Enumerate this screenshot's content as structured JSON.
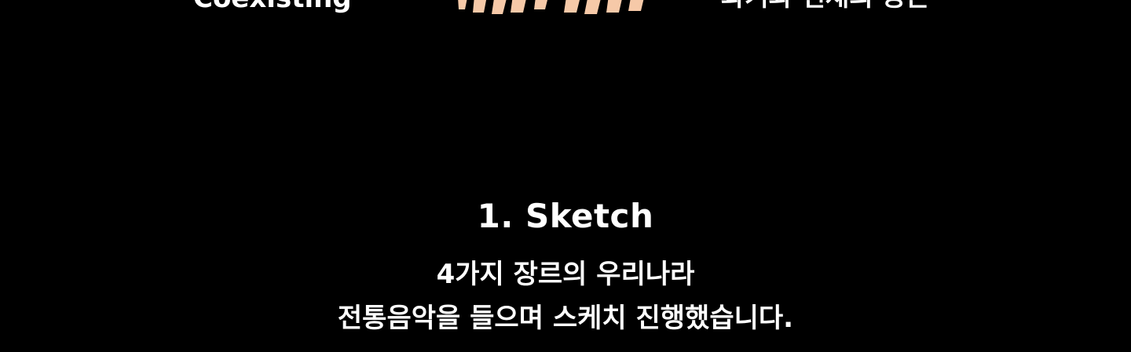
{
  "top": {
    "left_text": "Coexisting",
    "right_text": "과거와 현재의 공존"
  },
  "section": {
    "title": "1. Sketch",
    "description_lines": [
      "4가지 장르의 우리나라",
      "전통음악을 들으며 스케치 진행했습니다."
    ]
  },
  "colors": {
    "background": "#000000",
    "text": "#ffffff",
    "accent": "#f6c9a8"
  },
  "icons": {
    "top_center": "lettering-graphic"
  }
}
